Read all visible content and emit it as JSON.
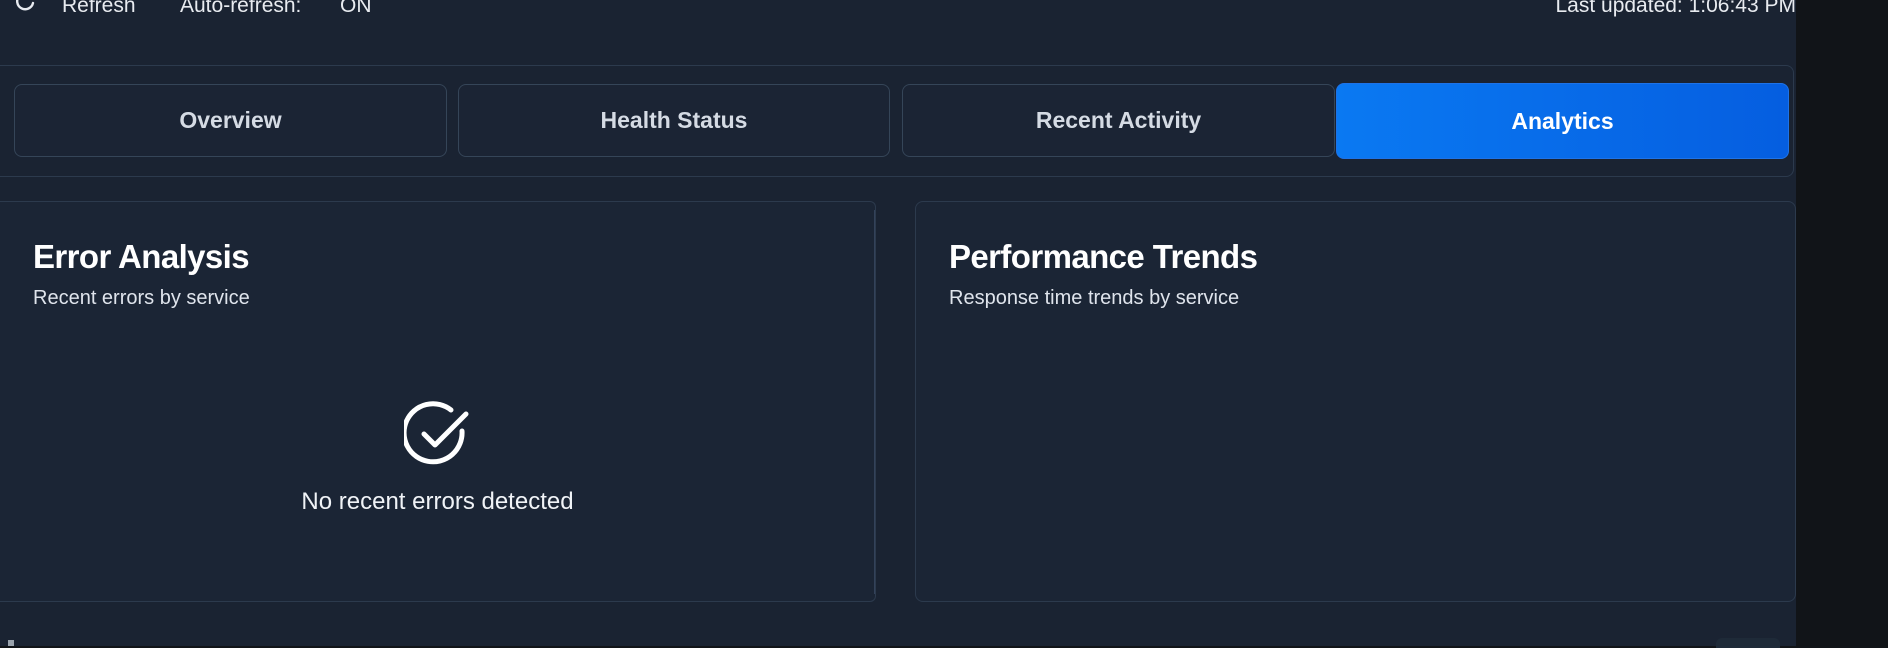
{
  "toolbar": {
    "refresh_label": "Refresh",
    "autorefresh_label": "Auto-refresh:",
    "autorefresh_value": "ON",
    "last_updated": "Last updated: 1:06:43 PM"
  },
  "tabs": [
    {
      "label": "Overview",
      "active": false
    },
    {
      "label": "Health Status",
      "active": false
    },
    {
      "label": "Recent Activity",
      "active": false
    },
    {
      "label": "Analytics",
      "active": true
    }
  ],
  "error_analysis": {
    "title": "Error Analysis",
    "subtitle": "Recent errors by service",
    "empty_message": "No recent errors detected",
    "icon": "check-circle-icon"
  },
  "performance_trends": {
    "title": "Performance Trends",
    "subtitle": "Response time trends by service"
  },
  "colors": {
    "background": "#1a2332",
    "accent": "#0a79f2",
    "outer": "#111418"
  }
}
